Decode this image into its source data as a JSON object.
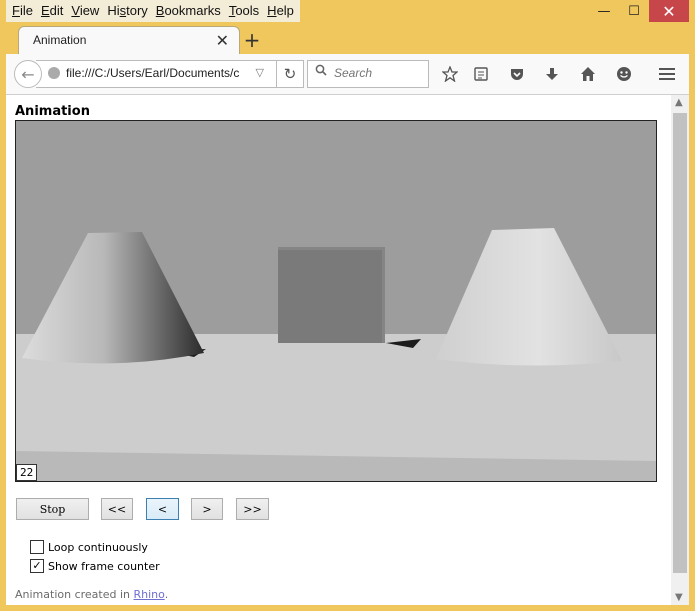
{
  "menubar": {
    "items": [
      "File",
      "Edit",
      "View",
      "History",
      "Bookmarks",
      "Tools",
      "Help"
    ],
    "underline": [
      "F",
      "E",
      "V",
      "s",
      "B",
      "T",
      "H"
    ]
  },
  "window_controls": {
    "minimize": "—",
    "maximize": "☐",
    "close": "✕"
  },
  "tab": {
    "title": "Animation",
    "close": "✕",
    "new_tab": "+"
  },
  "toolbar": {
    "back": "←",
    "url": "file:///C:/Users/Earl/Documents/c",
    "url_dropdown": "▽",
    "reload": "↻",
    "search_placeholder": "Search",
    "icons": [
      "star-icon",
      "reading-list-icon",
      "pocket-icon",
      "download-icon",
      "home-icon",
      "emoji-icon",
      "hamburger-menu-icon"
    ]
  },
  "page": {
    "heading": "Animation",
    "frame_counter": "22",
    "buttons": {
      "stop": "Stop",
      "first": "<<",
      "prev": "<",
      "next": ">",
      "last": ">>"
    },
    "options": [
      {
        "label": "Loop continuously",
        "checked": false
      },
      {
        "label": "Show frame counter",
        "checked": true
      }
    ],
    "footer_prefix": "Animation created in ",
    "footer_link": "Rhino",
    "footer_suffix": "."
  },
  "colors": {
    "window_border": "#efc75c",
    "close_button": "#c7464a",
    "viewport_background": "#9d9d9d",
    "floor": "#cdcdcd",
    "link": "#6f6fd0"
  }
}
